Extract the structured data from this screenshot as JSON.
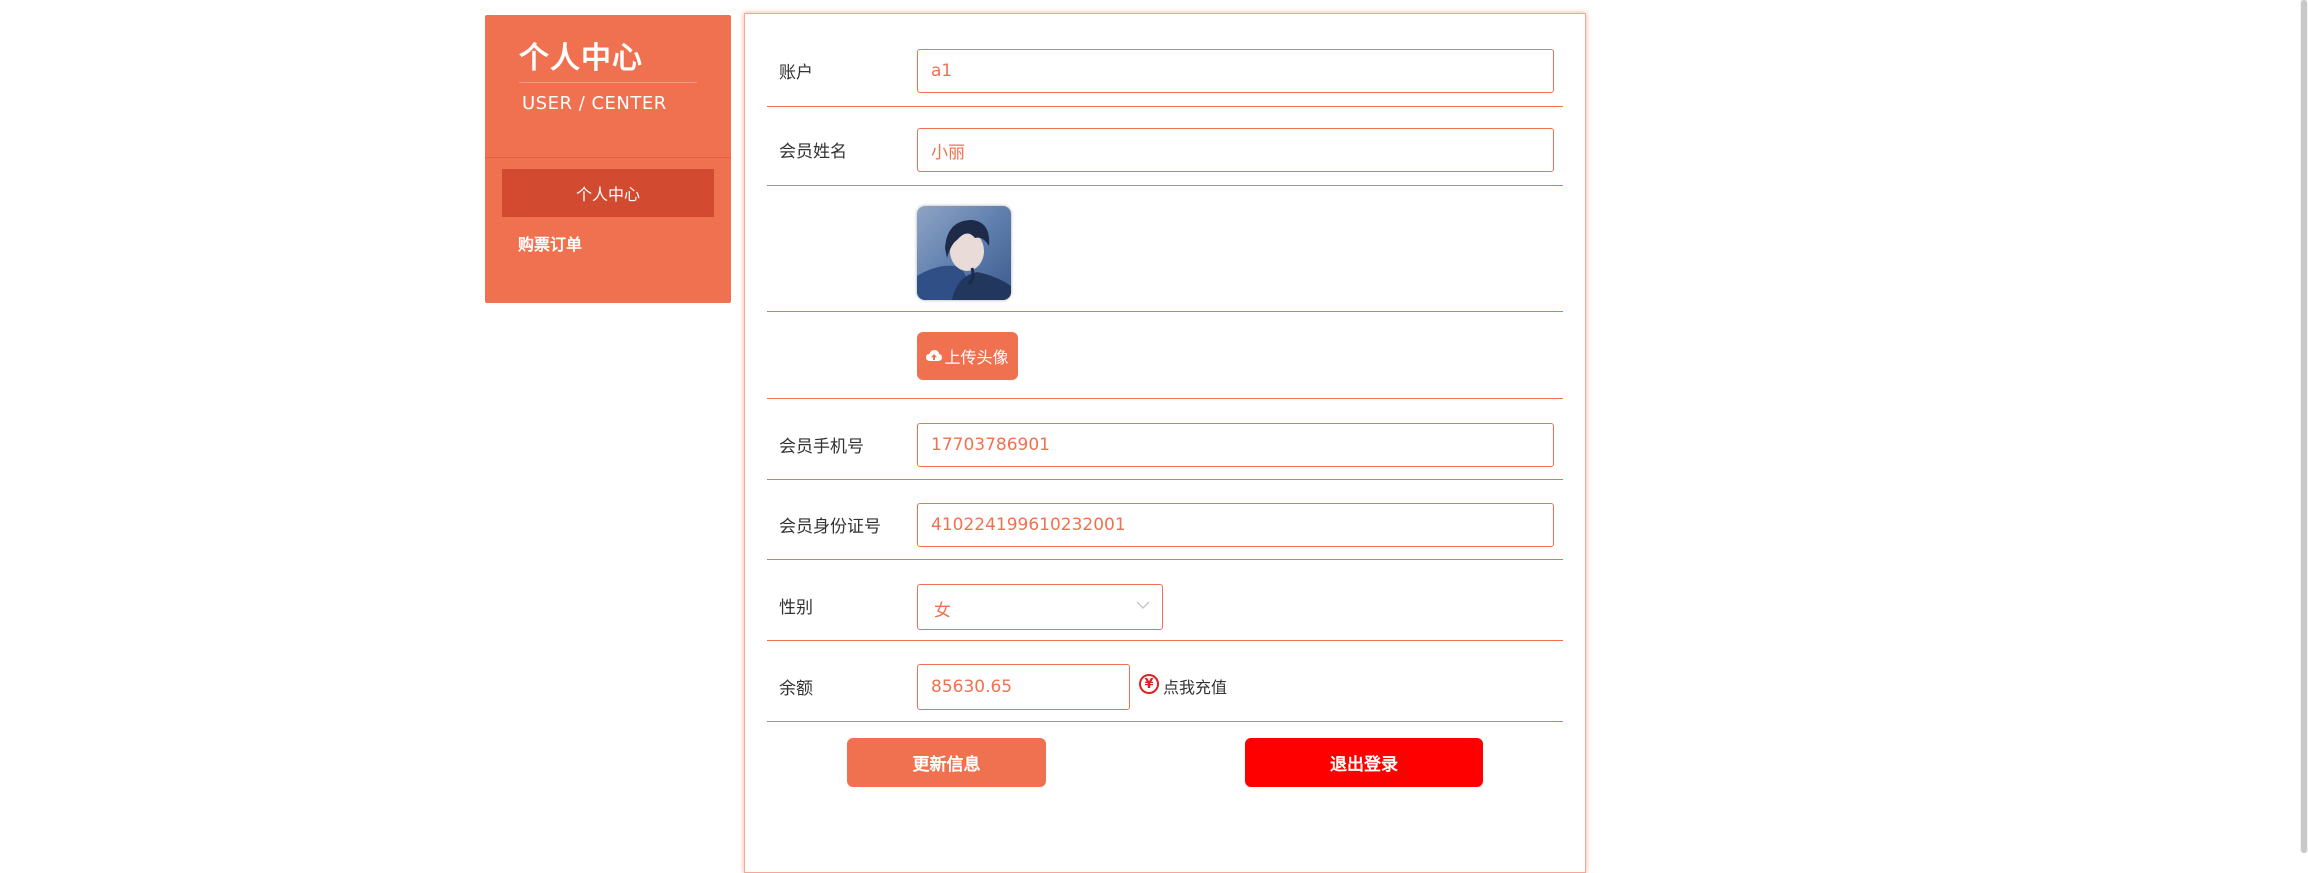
{
  "sidebar": {
    "title": "个人中心",
    "subtitle": "USER / CENTER",
    "items": [
      {
        "label": "个人中心",
        "active": true
      },
      {
        "label": "购票订单",
        "active": false
      }
    ]
  },
  "form": {
    "account": {
      "label": "账户",
      "value": "a1"
    },
    "name": {
      "label": "会员姓名",
      "value": "小丽"
    },
    "avatar": {
      "icon": "avatar-image"
    },
    "upload": {
      "label": "上传头像",
      "icon": "cloud-upload-icon"
    },
    "phone": {
      "label": "会员手机号",
      "value": "17703786901"
    },
    "idcard": {
      "label": "会员身份证号",
      "value": "410224199610232001"
    },
    "gender": {
      "label": "性别",
      "value": "女",
      "icon": "chevron-down-icon"
    },
    "balance": {
      "label": "余额",
      "value": "85630.65",
      "recharge_label": "点我充值",
      "recharge_icon": "¥"
    }
  },
  "actions": {
    "update_label": "更新信息",
    "logout_label": "退出登录"
  },
  "colors": {
    "accent": "#f07150",
    "accent_dark": "#d24a30",
    "danger": "#ff0000"
  }
}
